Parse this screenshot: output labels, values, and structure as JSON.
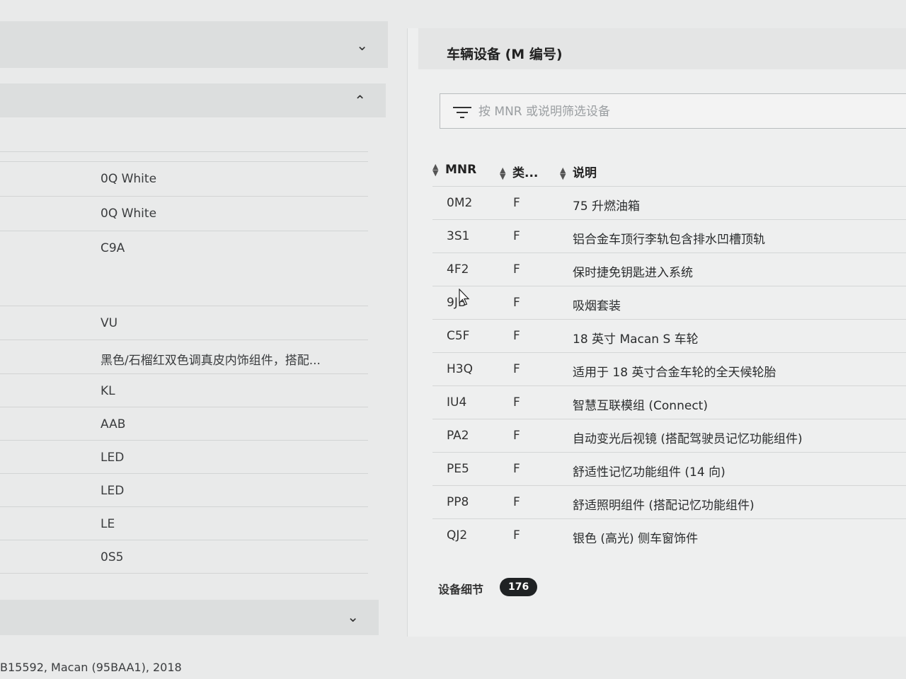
{
  "left_panel": {
    "items": [
      "0Q White",
      "0Q White",
      "C9A",
      "VU",
      "黑色/石榴红双色调真皮内饰组件，搭配...",
      "KL",
      "AAB",
      "LED",
      "LED",
      "LE",
      "0S5"
    ]
  },
  "footer": {
    "vehicle_info": "B15592, Macan (95BAA1), 2018"
  },
  "equipment": {
    "title": "车辆设备 (M 编号)",
    "filter_placeholder": "按 MNR 或说明筛选设备",
    "columns": {
      "mnr": "MNR",
      "type": "类...",
      "description": "说明"
    },
    "rows": [
      {
        "mnr": "0M2",
        "type": "F",
        "description": "75 升燃油箱"
      },
      {
        "mnr": "3S1",
        "type": "F",
        "description": "铝合金车顶行李轨包含排水凹槽顶轨"
      },
      {
        "mnr": "4F2",
        "type": "F",
        "description": "保时捷免钥匙进入系统"
      },
      {
        "mnr": "9JB",
        "type": "F",
        "description": "吸烟套装"
      },
      {
        "mnr": "C5F",
        "type": "F",
        "description": "18 英寸 Macan S 车轮"
      },
      {
        "mnr": "H3Q",
        "type": "F",
        "description": "适用于 18 英寸合金车轮的全天候轮胎"
      },
      {
        "mnr": "IU4",
        "type": "F",
        "description": "智慧互联模组 (Connect)"
      },
      {
        "mnr": "PA2",
        "type": "F",
        "description": "自动变光后视镜 (搭配驾驶员记忆功能组件)"
      },
      {
        "mnr": "PE5",
        "type": "F",
        "description": "舒适性记忆功能组件 (14 向)"
      },
      {
        "mnr": "PP8",
        "type": "F",
        "description": "舒适照明组件 (搭配记忆功能组件)"
      },
      {
        "mnr": "QJ2",
        "type": "F",
        "description": "银色 (高光) 侧车窗饰件"
      }
    ],
    "details_label": "设备细节",
    "details_count": "176"
  }
}
